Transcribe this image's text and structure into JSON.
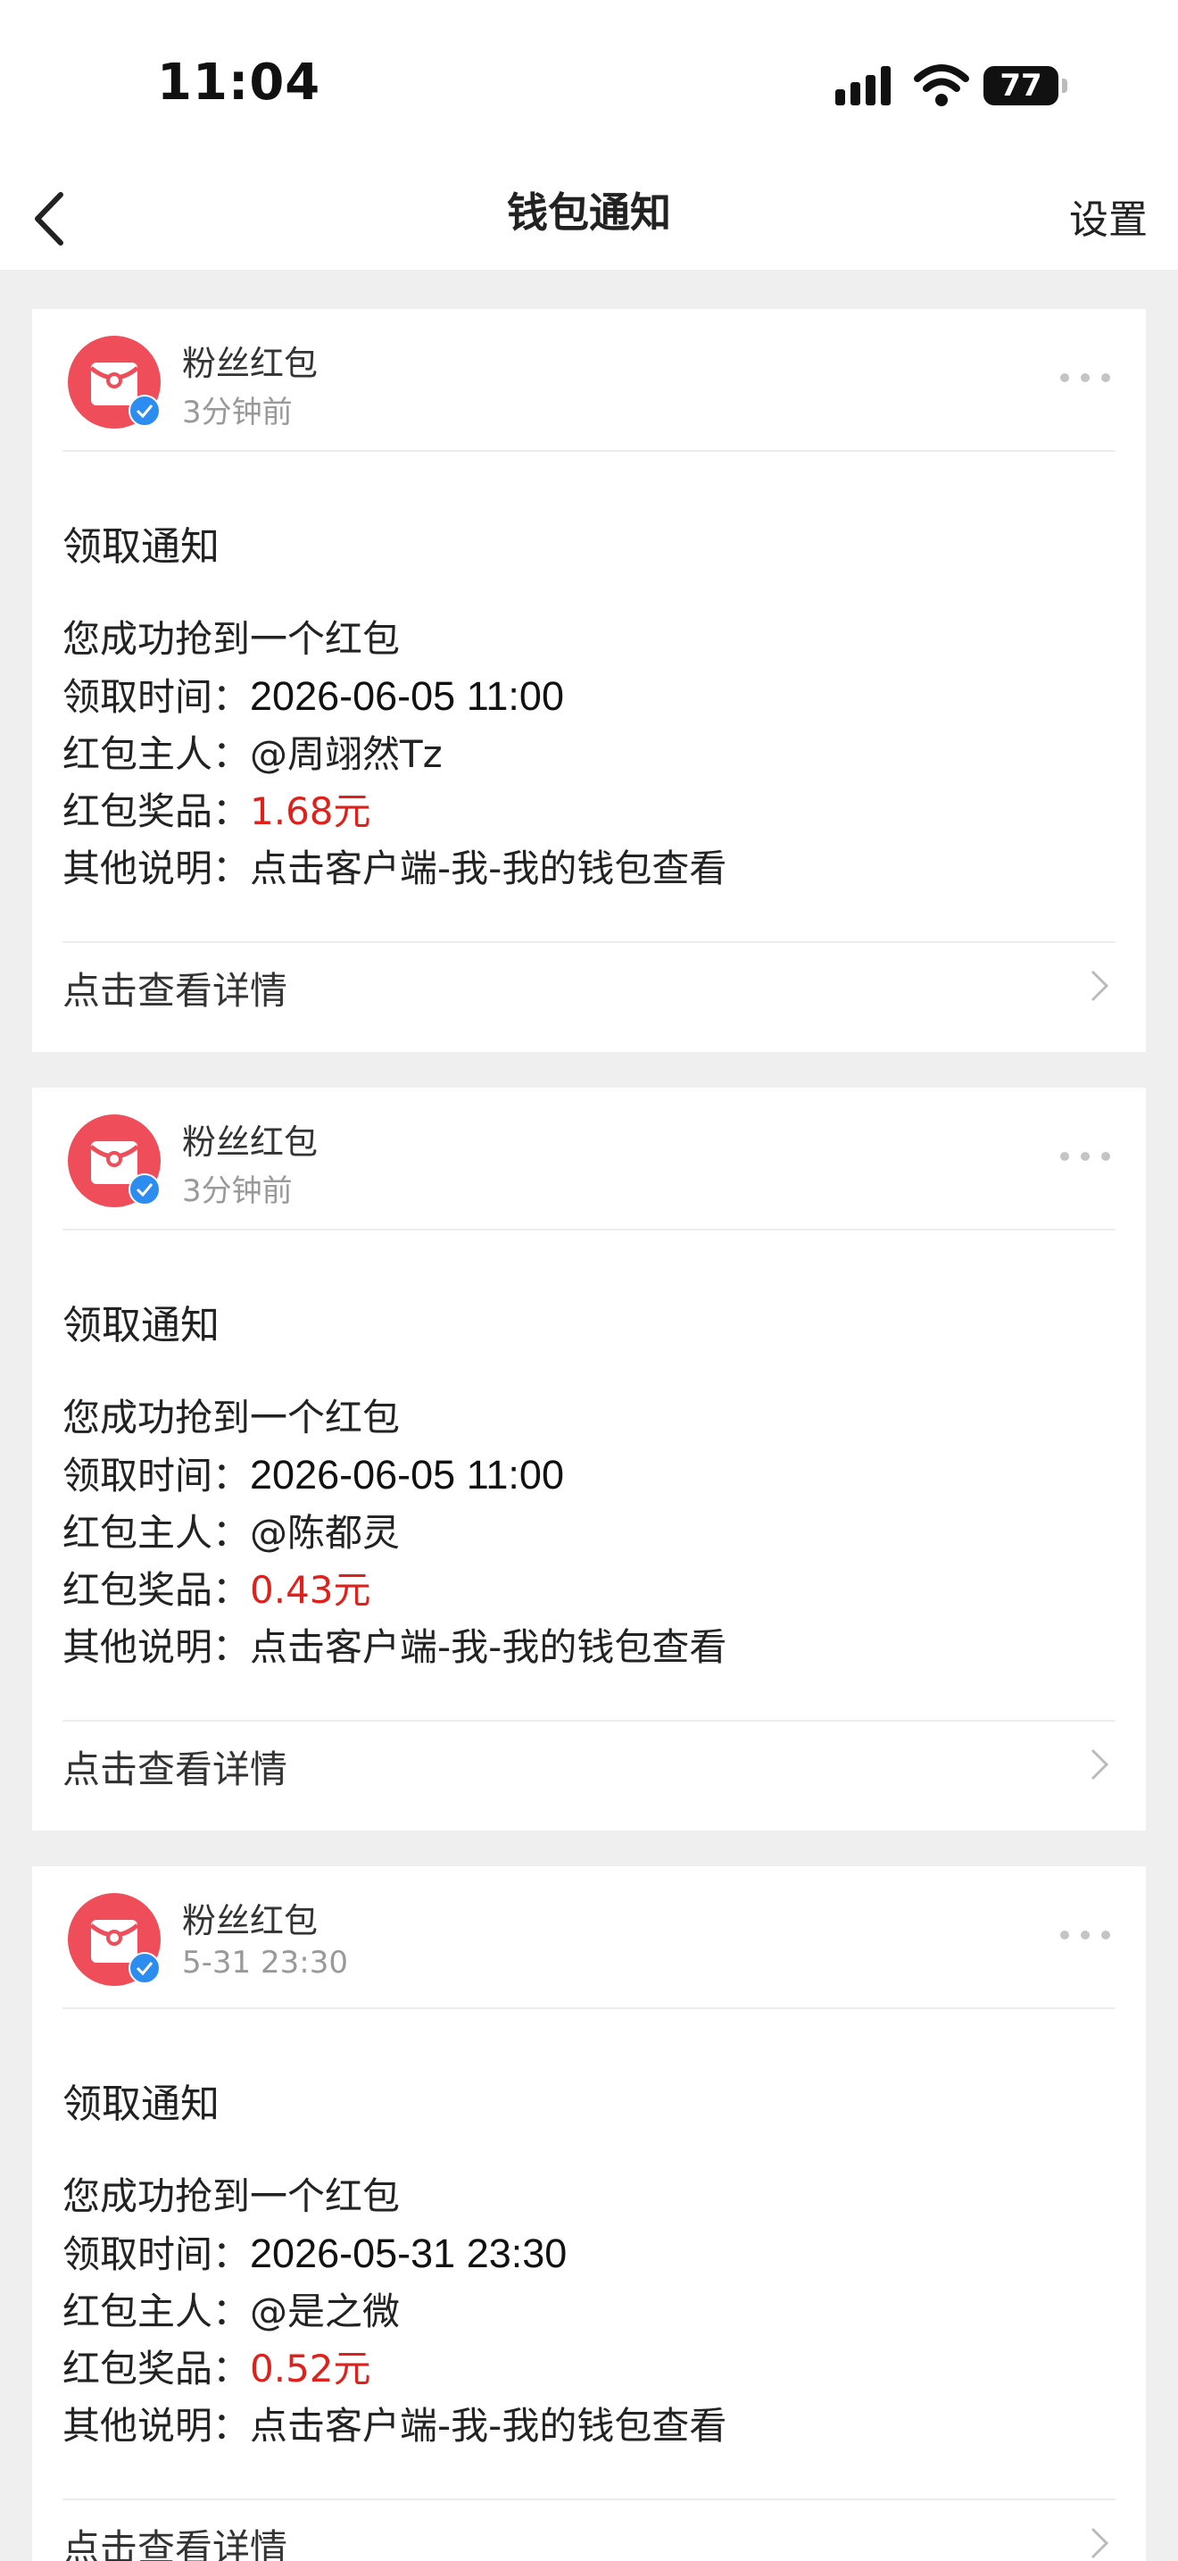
{
  "status_bar": {
    "time": "11:04",
    "battery": "77",
    "icons": [
      "signal-icon",
      "wifi-icon",
      "battery-icon"
    ]
  },
  "nav": {
    "title": "钱包通知",
    "settings_label": "设置",
    "back_icon": "chevron-left-icon"
  },
  "colors": {
    "accent_red": "#e0201b",
    "avatar_red": "#ef4d5a",
    "verified_blue": "#2d8cf0",
    "background": "#efefef"
  },
  "notifications": [
    {
      "sender": "粉丝红包",
      "time": "3分钟前",
      "title": "领取通知",
      "intro": "您成功抢到一个红包",
      "claim_time_label": "领取时间：",
      "claim_time": "2026-06-05 11:00",
      "owner_label": "红包主人：",
      "owner": "@周翊然Tz",
      "prize_label": "红包奖品：",
      "prize": "1.68元",
      "note_label": "其他说明：",
      "note": "点击客户端-我-我的钱包查看",
      "details_label": "点击查看详情"
    },
    {
      "sender": "粉丝红包",
      "time": "3分钟前",
      "title": "领取通知",
      "intro": "您成功抢到一个红包",
      "claim_time_label": "领取时间：",
      "claim_time": "2026-06-05 11:00",
      "owner_label": "红包主人：",
      "owner": "@陈都灵",
      "prize_label": "红包奖品：",
      "prize": "0.43元",
      "note_label": "其他说明：",
      "note": "点击客户端-我-我的钱包查看",
      "details_label": "点击查看详情"
    },
    {
      "sender": "粉丝红包",
      "time": "5-31 23:30",
      "title": "领取通知",
      "intro": "您成功抢到一个红包",
      "claim_time_label": "领取时间：",
      "claim_time": "2026-05-31 23:30",
      "owner_label": "红包主人：",
      "owner": "@是之微",
      "prize_label": "红包奖品：",
      "prize": "0.52元",
      "note_label": "其他说明：",
      "note": "点击客户端-我-我的钱包查看",
      "details_label": "点击查看详情"
    }
  ]
}
